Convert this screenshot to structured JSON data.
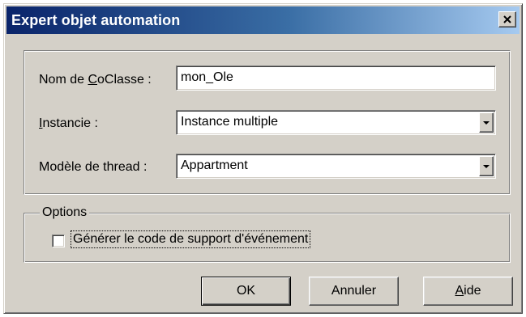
{
  "window": {
    "title": "Expert objet automation"
  },
  "fields": {
    "coclass": {
      "label_pre": "Nom de ",
      "label_u": "C",
      "label_post": "oClasse :",
      "value": "mon_Ole"
    },
    "instancing": {
      "label_u": "I",
      "label_post": "nstancie :",
      "value": "Instance multiple"
    },
    "threading": {
      "label": "Modèle de thread :",
      "value": "Appartment"
    }
  },
  "options": {
    "legend": "Options",
    "event_support": {
      "label": "Générer le code de support d'événement",
      "checked": false
    }
  },
  "buttons": {
    "ok": "OK",
    "cancel": "Annuler",
    "help_u": "A",
    "help_post": "ide"
  },
  "icons": {
    "close": "close-icon",
    "dropdown": "chevron-down-icon"
  }
}
